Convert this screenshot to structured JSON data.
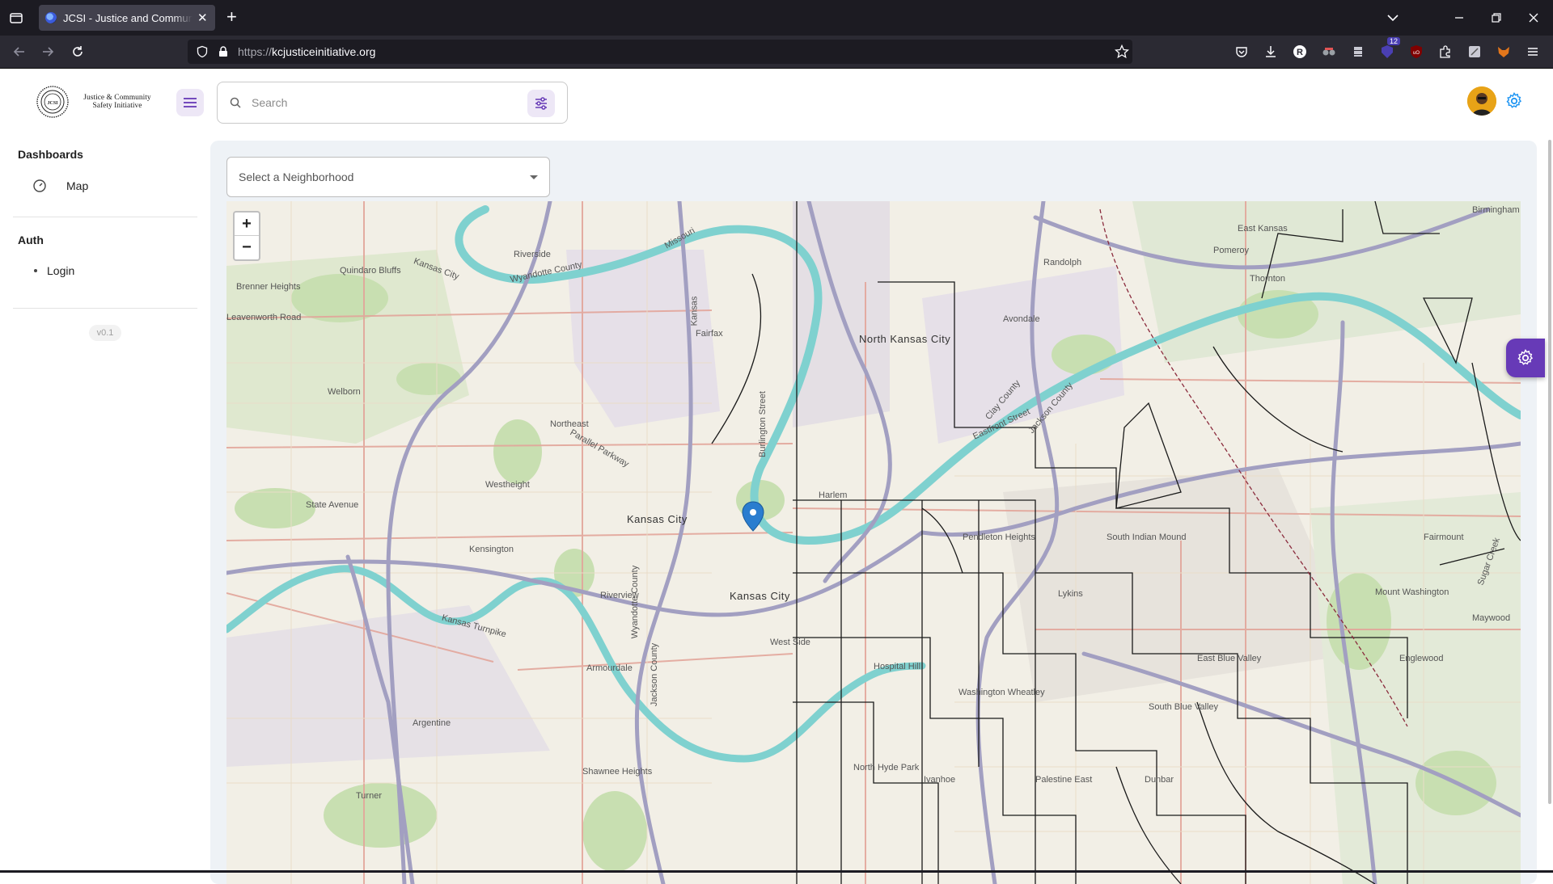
{
  "browser": {
    "tab_title": "JCSI - Justice and Community Safety Initiative",
    "url_protocol": "https://",
    "url_domain": "kcjusticeinitiative.org",
    "extension_badge": "12"
  },
  "header": {
    "logo_seal_text": "JCSI",
    "logo_text": "Justice & Community Safety Initiative",
    "search_placeholder": "Search"
  },
  "sidebar": {
    "sections": [
      {
        "heading": "Dashboards",
        "items": [
          {
            "label": "Map",
            "icon": "dashboard-icon"
          }
        ]
      },
      {
        "heading": "Auth",
        "items": [
          {
            "label": "Login",
            "icon": "bullet-icon"
          }
        ]
      }
    ],
    "version": "v0.1"
  },
  "main": {
    "neighborhood_select_placeholder": "Select a Neighborhood"
  },
  "map": {
    "zoom_in": "+",
    "zoom_out": "−",
    "labels": [
      "Riverside",
      "Wyandotte County",
      "Kansas City",
      "Missouri",
      "Quindaro Bluffs",
      "Brenner Heights",
      "Fairfax",
      "North Kansas City",
      "Burlington Street",
      "Kansas",
      "Clay County",
      "Jackson County",
      "Welborn",
      "Northeast",
      "Parallel Parkway",
      "Westheight",
      "Kansas City",
      "Kansas City",
      "State Avenue",
      "Kensington",
      "Harlem",
      "Pendleton Heights",
      "South Indian Mound",
      "Lykins",
      "Riverview",
      "Kansas Turnpike",
      "West Side",
      "Hospital Hill",
      "Washington Wheatley",
      "East Blue Valley",
      "South Blue Valley",
      "Armourdale",
      "Argentine",
      "Shawnee Heights",
      "Turner",
      "North Hyde Park",
      "Ivanhoe",
      "Palestine East",
      "Dunbar",
      "Fairmount",
      "Sugar Creek",
      "Mount Washington",
      "Maywood",
      "Englewood",
      "Birmingham",
      "Thornton",
      "Randolph",
      "East Kansas",
      "Avondale",
      "Leavenworth Road",
      "Pomeroy",
      "Eastfront Street",
      "Wyandotte County",
      "Jackson County"
    ]
  },
  "colors": {
    "accent": "#673ab7",
    "accent_light": "#ede7f6",
    "river": "#7fd1cf",
    "highway": "#a29fc1",
    "arterial": "#e2a59a",
    "boundary": "#1a1a1a"
  }
}
